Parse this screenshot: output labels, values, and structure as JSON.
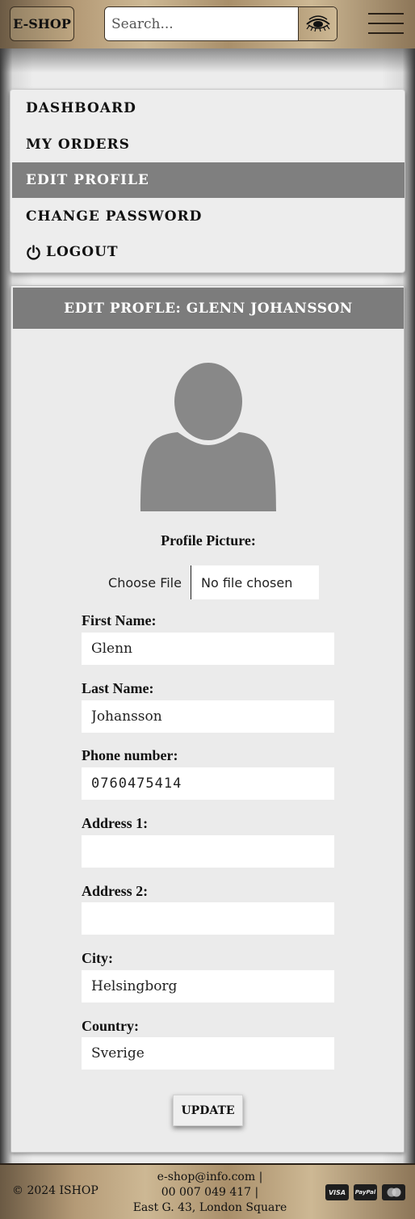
{
  "header": {
    "logo": "E-SHOP",
    "search_placeholder": "Search...",
    "search_icon": "eye-icon",
    "menu_icon": "hamburger-icon"
  },
  "sidebar": {
    "items": [
      {
        "label": "DASHBOARD",
        "active": false
      },
      {
        "label": "MY ORDERS",
        "active": false
      },
      {
        "label": "EDIT PROFILE",
        "active": true
      },
      {
        "label": "CHANGE PASSWORD",
        "active": false
      },
      {
        "label": "LOGOUT",
        "active": false,
        "icon": "power-icon"
      }
    ]
  },
  "profile": {
    "title": "EDIT PROFLE: GLENN JOHANSSON",
    "picture_label": "Profile Picture:",
    "file_button": "Choose File",
    "file_status": "No file chosen",
    "fields": [
      {
        "label": "First Name:",
        "value": "Glenn"
      },
      {
        "label": "Last Name:",
        "value": "Johansson"
      },
      {
        "label": "Phone number:",
        "value": "0760475414"
      },
      {
        "label": "Address 1:",
        "value": ""
      },
      {
        "label": "Address 2:",
        "value": ""
      },
      {
        "label": "City:",
        "value": "Helsingborg"
      },
      {
        "label": "Country:",
        "value": "Sverige"
      }
    ],
    "update_button": "UPDATE"
  },
  "footer": {
    "copyright": "© 2024 ISHOP",
    "email": "e-shop@info.com",
    "phone": "00 007 049 417",
    "address": "East G. 43, London Square",
    "separator": "|",
    "cards": [
      "VISA",
      "PayPal",
      "mastercard"
    ]
  },
  "colors": {
    "accent_bronze": "#b49a76",
    "active_menu": "#7f7f7f",
    "panel_title": "#7c7c7c"
  }
}
